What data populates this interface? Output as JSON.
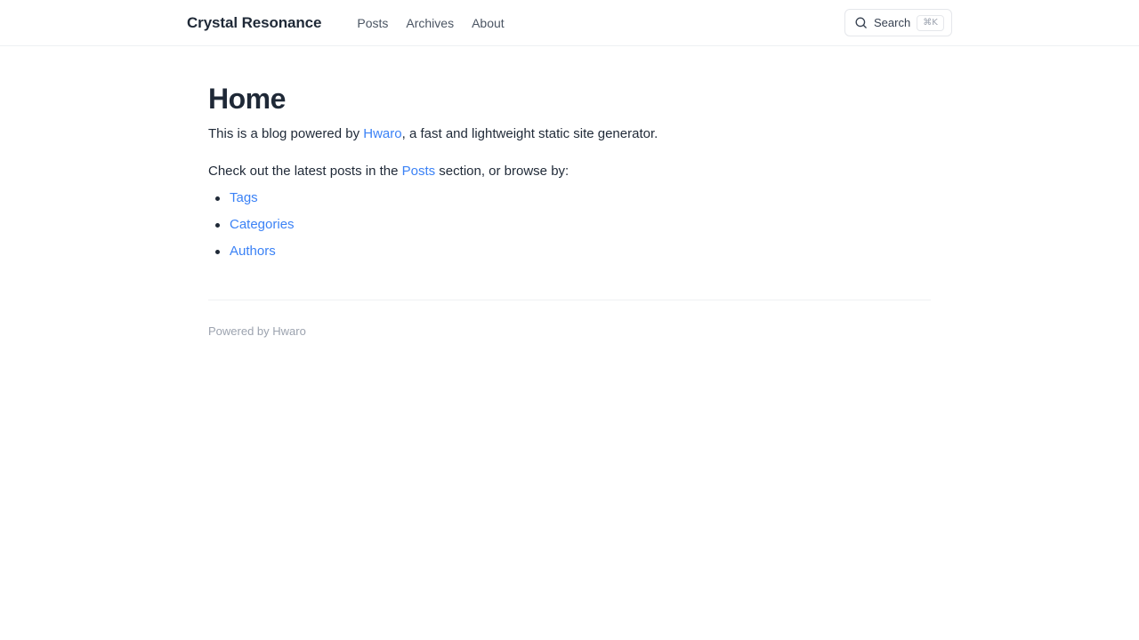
{
  "header": {
    "site_title": "Crystal Resonance",
    "nav": [
      {
        "label": "Posts"
      },
      {
        "label": "Archives"
      },
      {
        "label": "About"
      }
    ],
    "search": {
      "label": "Search",
      "shortcut": "⌘K",
      "icon": "search-icon"
    }
  },
  "main": {
    "title": "Home",
    "intro": {
      "before": "This is a blog powered by ",
      "link": "Hwaro",
      "after": ", a fast and lightweight static site generator."
    },
    "browse": {
      "before": "Check out the latest posts in the ",
      "link": "Posts",
      "after": " section, or browse by:"
    },
    "browse_list": [
      {
        "label": "Tags"
      },
      {
        "label": "Categories"
      },
      {
        "label": "Authors"
      }
    ]
  },
  "footer": {
    "text": "Powered by Hwaro"
  },
  "colors": {
    "accent": "#3b82f6",
    "text": "#1f2937",
    "muted": "#9ca3af",
    "border": "#e5e7eb"
  }
}
